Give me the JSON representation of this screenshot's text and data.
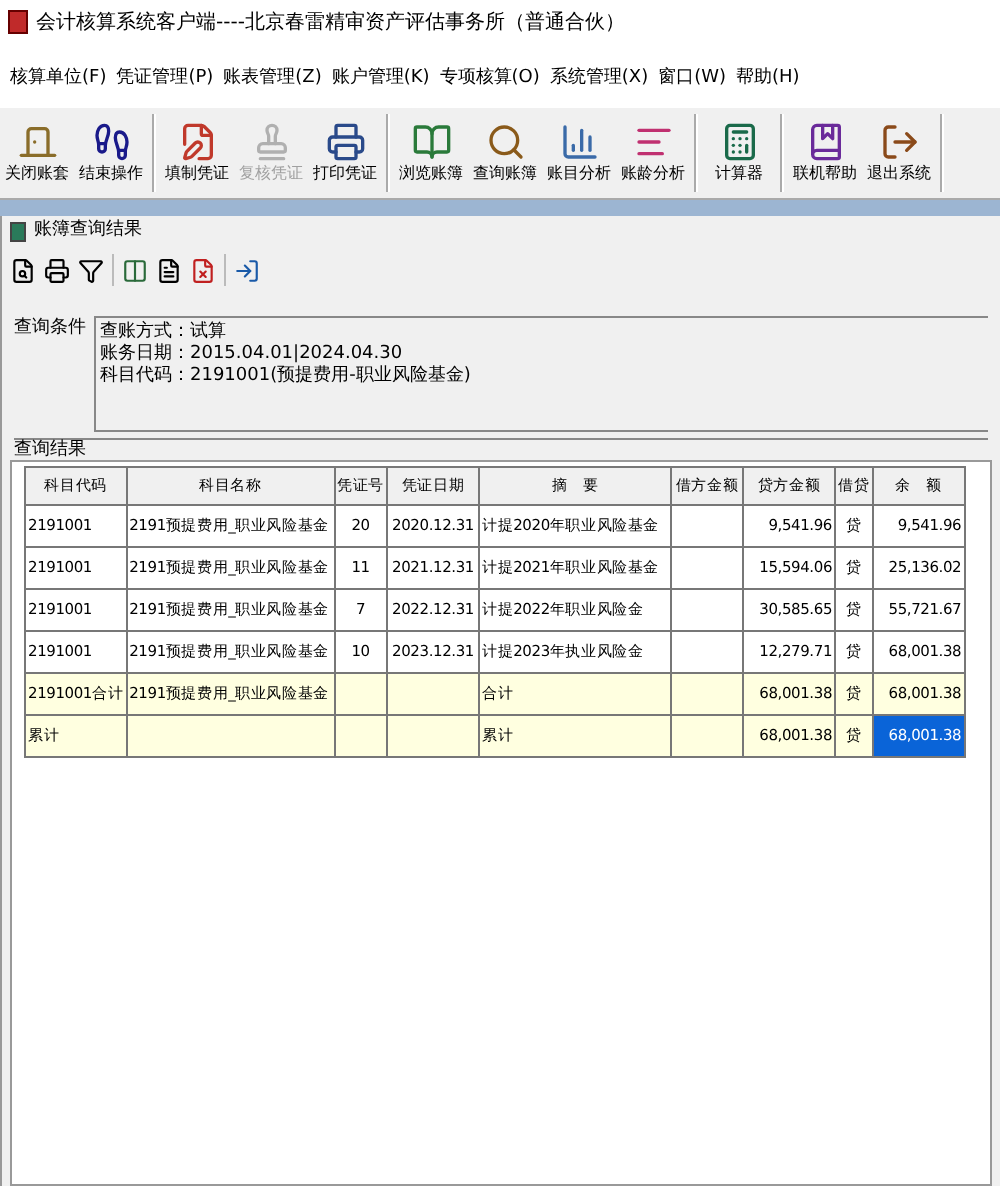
{
  "window": {
    "title": "会计核算系统客户端----北京春雷精审资产评估事务所（普通合伙）"
  },
  "menu": [
    "核算单位(F)",
    "凭证管理(P)",
    "账表管理(Z)",
    "账户管理(K)",
    "专项核算(O)",
    "系统管理(X)",
    "窗口(W)",
    "帮助(H)"
  ],
  "toolbar": [
    {
      "label": "关闭账套",
      "disabled": false,
      "separator_after": false
    },
    {
      "label": "结束操作",
      "disabled": false,
      "separator_after": true
    },
    {
      "label": "填制凭证",
      "disabled": false,
      "separator_after": false
    },
    {
      "label": "复核凭证",
      "disabled": true,
      "separator_after": false
    },
    {
      "label": "打印凭证",
      "disabled": false,
      "separator_after": true
    },
    {
      "label": "浏览账簿",
      "disabled": false,
      "separator_after": false
    },
    {
      "label": "查询账簿",
      "disabled": false,
      "separator_after": false
    },
    {
      "label": "账目分析",
      "disabled": false,
      "separator_after": false
    },
    {
      "label": "账龄分析",
      "disabled": false,
      "separator_after": true
    },
    {
      "label": "计算器",
      "disabled": false,
      "separator_after": true
    },
    {
      "label": "联机帮助",
      "disabled": false,
      "separator_after": false
    },
    {
      "label": "退出系统",
      "disabled": false,
      "separator_after": true
    }
  ],
  "subwindow": {
    "title": "账簿查询结果"
  },
  "query_conditions": {
    "label": "查询条件",
    "lines": [
      "查账方式：试算",
      "账务日期：2015.04.01|2024.04.30",
      "科目代码：2191001(预提费用-职业风险基金)"
    ]
  },
  "results": {
    "label": "查询结果",
    "columns": [
      "科目代码",
      "科目名称",
      "凭证号",
      "凭证日期",
      "摘　要",
      "借方金额",
      "贷方金额",
      "借贷",
      "余　额"
    ],
    "rows": [
      {
        "kind": "detail",
        "cells": [
          "2191001",
          "2191预提费用_职业风险基金",
          "20",
          "2020.12.31",
          "计提2020年职业风险基金",
          "",
          "9,541.96",
          "贷",
          "9,541.96"
        ],
        "balance_selected": false
      },
      {
        "kind": "detail",
        "cells": [
          "2191001",
          "2191预提费用_职业风险基金",
          "11",
          "2021.12.31",
          "计提2021年职业风险基金",
          "",
          "15,594.06",
          "贷",
          "25,136.02"
        ],
        "balance_selected": false
      },
      {
        "kind": "detail",
        "cells": [
          "2191001",
          "2191预提费用_职业风险基金",
          "7",
          "2022.12.31",
          "计提2022年职业风险金",
          "",
          "30,585.65",
          "贷",
          "55,721.67"
        ],
        "balance_selected": false
      },
      {
        "kind": "detail",
        "cells": [
          "2191001",
          "2191预提费用_职业风险基金",
          "10",
          "2023.12.31",
          "计提2023年执业风险金",
          "",
          "12,279.71",
          "贷",
          "68,001.38"
        ],
        "balance_selected": false
      },
      {
        "kind": "total",
        "cells": [
          "2191001合计",
          "2191预提费用_职业风险基金",
          "",
          "",
          "合计",
          "",
          "68,001.38",
          "贷",
          "68,001.38"
        ],
        "balance_selected": false
      },
      {
        "kind": "total",
        "cells": [
          "累计",
          "",
          "",
          "",
          "累计",
          "",
          "68,001.38",
          "贷",
          "68,001.38"
        ],
        "balance_selected": true
      }
    ]
  }
}
